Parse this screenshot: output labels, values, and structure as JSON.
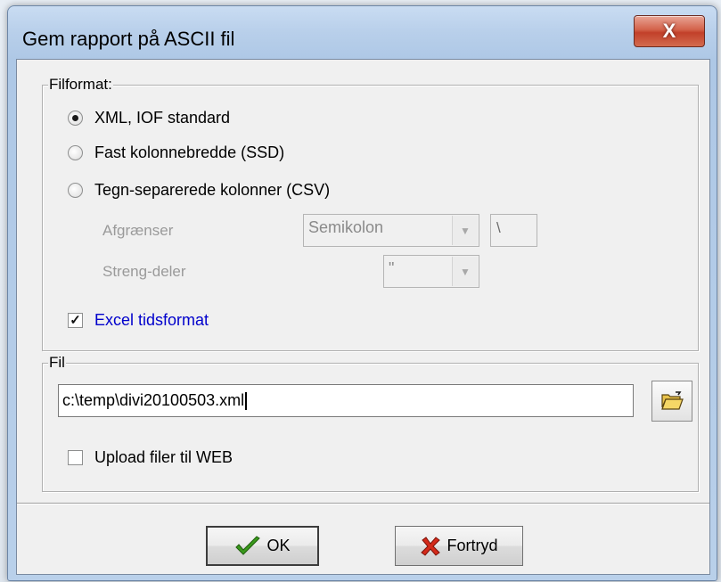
{
  "window": {
    "title": "Gem rapport på ASCII fil",
    "close_label": "X"
  },
  "filformat": {
    "label": "Filformat:",
    "options": [
      {
        "label": "XML, IOF standard",
        "checked": true
      },
      {
        "label": "Fast kolonnebredde (SSD)",
        "checked": false
      },
      {
        "label": "Tegn-separerede kolonner (CSV)",
        "checked": false
      }
    ],
    "delimiter_label": "Afgrænser",
    "delimiter_value": "Semikolon",
    "delimiter_char": "\\",
    "string_label": "Streng-deler",
    "string_value": "\"",
    "excel_label": "Excel tidsformat",
    "excel_checked": true
  },
  "fil": {
    "label": "Fil",
    "path": "c:\\temp\\divi20100503.xml",
    "upload_label": "Upload filer til WEB",
    "upload_checked": false
  },
  "buttons": {
    "ok_label": "OK",
    "cancel_label": "Fortryd"
  },
  "colors": {
    "excel_label": "#0000cc"
  }
}
